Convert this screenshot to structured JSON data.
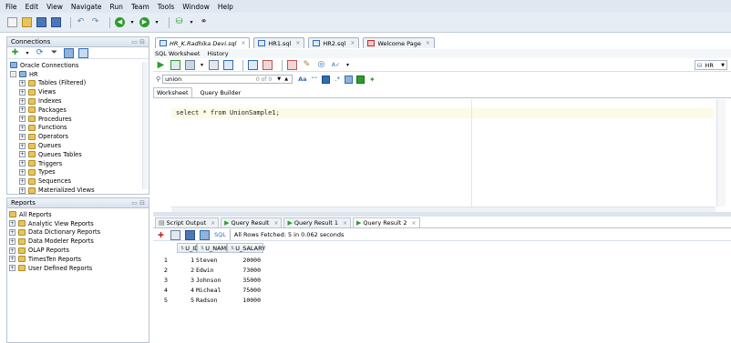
{
  "menu": [
    "File",
    "Edit",
    "View",
    "Navigate",
    "Run",
    "Team",
    "Tools",
    "Window",
    "Help"
  ],
  "connections_panel": {
    "title": "Connections",
    "tree": [
      {
        "label": "Oracle Connections",
        "level": 0,
        "expander": ""
      },
      {
        "label": "HR",
        "level": 0,
        "expander": "-"
      },
      {
        "label": "Tables (Filtered)",
        "level": 1,
        "expander": "+"
      },
      {
        "label": "Views",
        "level": 1,
        "expander": "+"
      },
      {
        "label": "Indexes",
        "level": 1,
        "expander": "+"
      },
      {
        "label": "Packages",
        "level": 1,
        "expander": "+"
      },
      {
        "label": "Procedures",
        "level": 1,
        "expander": "+"
      },
      {
        "label": "Functions",
        "level": 1,
        "expander": "+"
      },
      {
        "label": "Operators",
        "level": 1,
        "expander": "+"
      },
      {
        "label": "Queues",
        "level": 1,
        "expander": "+"
      },
      {
        "label": "Queues Tables",
        "level": 1,
        "expander": "+"
      },
      {
        "label": "Triggers",
        "level": 1,
        "expander": "+"
      },
      {
        "label": "Types",
        "level": 1,
        "expander": "+"
      },
      {
        "label": "Sequences",
        "level": 1,
        "expander": "+"
      },
      {
        "label": "Materialized Views",
        "level": 1,
        "expander": "+"
      }
    ]
  },
  "reports_panel": {
    "title": "Reports",
    "items": [
      {
        "label": "All Reports",
        "expander": ""
      },
      {
        "label": "Analytic View Reports",
        "expander": "+"
      },
      {
        "label": "Data Dictionary Reports",
        "expander": "+"
      },
      {
        "label": "Data Modeler Reports",
        "expander": "+"
      },
      {
        "label": "OLAP Reports",
        "expander": "+"
      },
      {
        "label": "TimesTen Reports",
        "expander": "+"
      },
      {
        "label": "User Defined Reports",
        "expander": "+"
      }
    ]
  },
  "doc_tabs": [
    {
      "label": "HR_K.Radhika Devi.sql",
      "active": true
    },
    {
      "label": "HR1.sql",
      "active": false
    },
    {
      "label": "HR2.sql",
      "active": false
    },
    {
      "label": "Welcome Page",
      "active": false
    }
  ],
  "worksheet_tabs": [
    "SQL Worksheet",
    "History"
  ],
  "connection_select": "HR",
  "search": {
    "value": "union",
    "count": "0 of 0"
  },
  "editor_tabs": [
    "Worksheet",
    "Query Builder"
  ],
  "editor": {
    "code": "select * from UnionSample1;"
  },
  "result_tabs": [
    {
      "label": "Script Output",
      "active": false
    },
    {
      "label": "Query Result",
      "active": false
    },
    {
      "label": "Query Result 1",
      "active": false
    },
    {
      "label": "Query Result 2",
      "active": true
    }
  ],
  "result_toolbar": {
    "sql_label": "SQL",
    "status": "All Rows Fetched: 5 in 0.062 seconds"
  },
  "grid": {
    "columns": [
      "U_ID",
      "U_NAME",
      "U_SALARY"
    ],
    "rows": [
      {
        "n": "1",
        "id": "1",
        "name": "Steven",
        "salary": "20000"
      },
      {
        "n": "2",
        "id": "2",
        "name": "Edwin",
        "salary": "73000"
      },
      {
        "n": "3",
        "id": "3",
        "name": "Johnson",
        "salary": "35000"
      },
      {
        "n": "4",
        "id": "4",
        "name": "Micheal",
        "salary": "75000"
      },
      {
        "n": "5",
        "id": "5",
        "name": "Radson",
        "salary": "10000"
      }
    ]
  },
  "colors": {
    "accent": "#2f6db5",
    "menubar": "#dfe8f1",
    "editor_line": "#fdfbe6",
    "run": "#2d9c2d"
  }
}
